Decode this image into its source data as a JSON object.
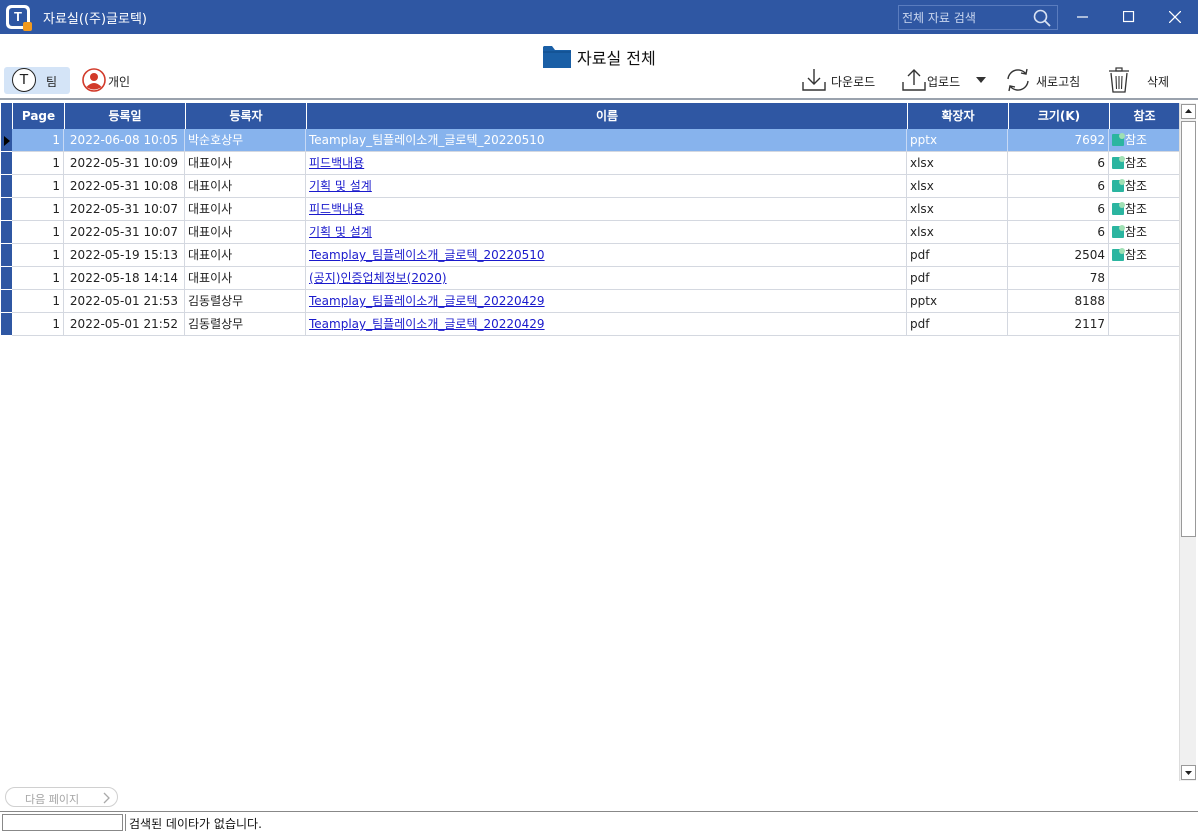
{
  "window": {
    "title": "자료실((주)글로텍)",
    "search_placeholder": "전체 자료 검색"
  },
  "header": {
    "folder_title": "자료실 전체",
    "scope_buttons": {
      "team": "팀",
      "personal": "개인",
      "team_letter": "T"
    }
  },
  "toolbar": {
    "download": "다운로드",
    "upload": "업로드",
    "refresh": "새로고침",
    "delete": "삭제"
  },
  "grid": {
    "columns": [
      "Page",
      "등록일",
      "등록자",
      "이름",
      "확장자",
      "크기(K)",
      "참조"
    ],
    "rows": [
      {
        "page": "1",
        "date": "2022-06-08 10:05",
        "user": "박순호상무",
        "name": "Teamplay_팀플레이소개_글로텍_20220510",
        "ext": "pptx",
        "size": "7692",
        "ref": "참조",
        "selected": true
      },
      {
        "page": "1",
        "date": "2022-05-31 10:09",
        "user": "대표이사",
        "name": "피드백내용",
        "ext": "xlsx",
        "size": "6",
        "ref": "참조"
      },
      {
        "page": "1",
        "date": "2022-05-31 10:08",
        "user": "대표이사",
        "name": "기획 및 설계",
        "ext": "xlsx",
        "size": "6",
        "ref": "참조"
      },
      {
        "page": "1",
        "date": "2022-05-31 10:07",
        "user": "대표이사",
        "name": "피드백내용",
        "ext": "xlsx",
        "size": "6",
        "ref": "참조"
      },
      {
        "page": "1",
        "date": "2022-05-31 10:07",
        "user": "대표이사",
        "name": "기획 및 설계",
        "ext": "xlsx",
        "size": "6",
        "ref": "참조"
      },
      {
        "page": "1",
        "date": "2022-05-19 15:13",
        "user": "대표이사",
        "name": "Teamplay_팀플레이소개_글로텍_20220510",
        "ext": "pdf",
        "size": "2504",
        "ref": "참조"
      },
      {
        "page": "1",
        "date": "2022-05-18 14:14",
        "user": "대표이사",
        "name": "(공지)인증업체정보(2020)",
        "ext": "pdf",
        "size": "78",
        "ref": ""
      },
      {
        "page": "1",
        "date": "2022-05-01 21:53",
        "user": "김동렬상무",
        "name": "Teamplay_팀플레이소개_글로텍_20220429",
        "ext": "pptx",
        "size": "8188",
        "ref": ""
      },
      {
        "page": "1",
        "date": "2022-05-01 21:52",
        "user": "김동렬상무",
        "name": "Teamplay_팀플레이소개_글로텍_20220429",
        "ext": "pdf",
        "size": "2117",
        "ref": ""
      }
    ]
  },
  "footer": {
    "next_page": "다음 페이지",
    "status": "검색된 데이타가 없습니다."
  },
  "colors": {
    "titlebar": "#2f57a3",
    "selected_row": "#87b3ed",
    "link": "#1a1acc"
  }
}
